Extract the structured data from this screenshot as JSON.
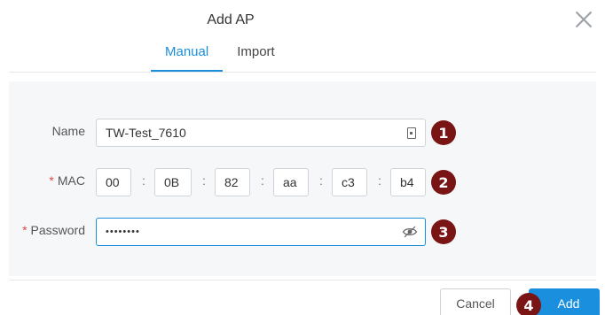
{
  "dialog": {
    "title": "Add AP",
    "tabs": [
      {
        "label": "Manual",
        "active": true
      },
      {
        "label": "Import",
        "active": false
      }
    ]
  },
  "form": {
    "name": {
      "label": "Name",
      "value": "TW-Test_7610"
    },
    "mac": {
      "label": "MAC",
      "required_mark": "*",
      "octets": [
        "00",
        "0B",
        "82",
        "aa",
        "c3",
        "b4"
      ],
      "separator": ":"
    },
    "password": {
      "label": "Password",
      "required_mark": "*",
      "value": "••••••••"
    }
  },
  "annotations": [
    "1",
    "2",
    "3",
    "4"
  ],
  "footer": {
    "cancel_label": "Cancel",
    "add_label": "Add"
  },
  "colors": {
    "accent": "#1a8fde",
    "required": "#e0474c",
    "badge": "#7a1515"
  },
  "icons": {
    "close": "close-icon",
    "name_field": "contact-card-icon",
    "password_field": "eye-icon"
  }
}
